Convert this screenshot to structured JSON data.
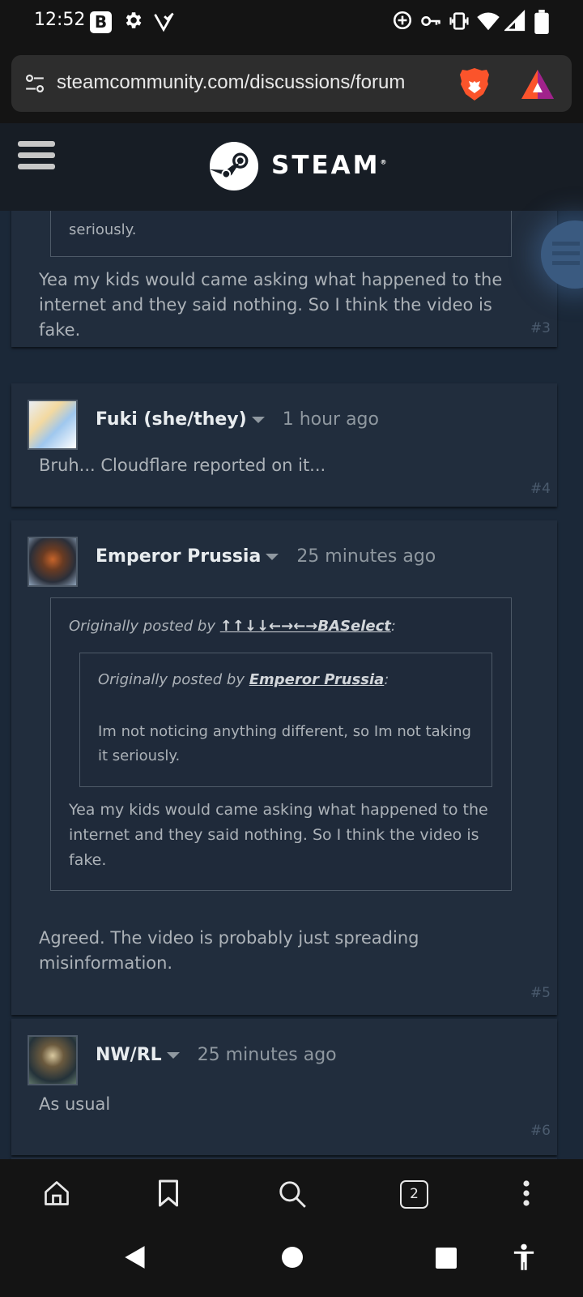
{
  "status_bar": {
    "time": "12:52",
    "app_badge": "B"
  },
  "browser": {
    "url": "steamcommunity.com/discussions/forum",
    "tab_count": "2"
  },
  "steam_header": {
    "wordmark": "STEAM",
    "registered": "®"
  },
  "posts": [
    {
      "partial_quote_text": "seriously.",
      "text_lines": [
        "Yea my kids would came asking what happened to the",
        "internet and they said nothing. So I think the video is",
        "fake."
      ],
      "number": "#3"
    },
    {
      "author": "Fuki (she/they)",
      "time": "1 hour ago",
      "text": "Bruh... Cloudflare reported on it...",
      "number": "#4"
    },
    {
      "author": "Emperor Prussia",
      "time": "25 minutes ago",
      "quote": {
        "prefix": "Originally posted by ",
        "author": "↑↑↓↓←→←→BASelect",
        "suffix": ":",
        "nested": {
          "prefix": "Originally posted by ",
          "author": "Emperor Prussia",
          "suffix": ":",
          "text_lines": [
            "Im not noticing anything different, so Im not taking",
            "it seriously."
          ]
        },
        "text_lines": [
          "Yea my kids would came asking what happened to the",
          "internet and they said nothing. So I think the video is",
          "fake."
        ]
      },
      "text_lines": [
        "Agreed. The video is probably just spreading",
        "misinformation."
      ],
      "number": "#5"
    },
    {
      "author": "NW/RL",
      "time": "25 minutes ago",
      "text": "As usual",
      "number": "#6"
    }
  ],
  "icons": {
    "status": [
      "settings-icon",
      "location-check-icon",
      "data-saver-icon",
      "vpn-key-icon",
      "vibrate-icon",
      "wifi-icon",
      "signal-icon",
      "battery-icon"
    ],
    "browser": [
      "site-settings-icon",
      "brave-shields-icon",
      "brave-rewards-icon",
      "home-icon",
      "bookmark-icon",
      "search-icon",
      "tabs-icon",
      "more-icon"
    ],
    "nav": [
      "back-icon",
      "home-circle-icon",
      "recents-icon",
      "accessibility-icon"
    ]
  },
  "colors": {
    "page_bg": "#1b2838",
    "post_bg": "#212d3d",
    "steam_header": "#171d25",
    "brave_orange": "#fb542b"
  }
}
